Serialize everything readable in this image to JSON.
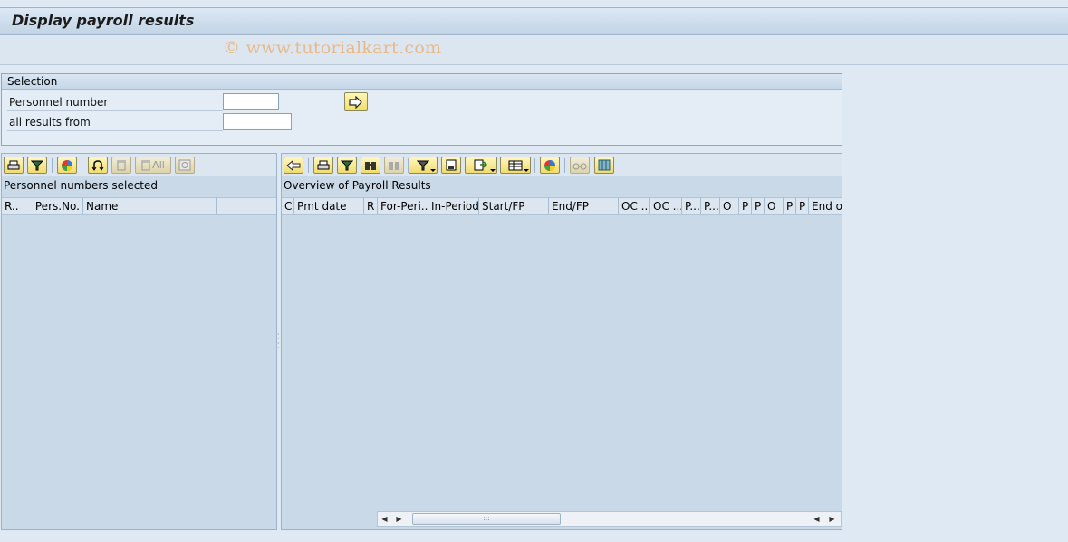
{
  "window": {
    "title": "Display payroll results",
    "watermark": "© www.tutorialkart.com"
  },
  "selection": {
    "header": "Selection",
    "fields": [
      {
        "label": "Personnel number",
        "value": ""
      },
      {
        "label": "all results from",
        "value": ""
      }
    ],
    "execute_icon": "execute-arrow-icon"
  },
  "left_panel": {
    "title": "Personnel numbers selected",
    "toolbar": [
      {
        "icon": "print-icon",
        "enabled": true
      },
      {
        "icon": "filter-icon",
        "enabled": true
      },
      {
        "icon": "color-wheel-icon",
        "enabled": true
      },
      {
        "icon": "refresh-icon",
        "enabled": true
      },
      {
        "icon": "delete-icon",
        "enabled": false
      },
      {
        "icon": "delete-all-icon",
        "label": "All",
        "enabled": false
      },
      {
        "icon": "reload-icon",
        "enabled": false
      }
    ],
    "columns": [
      "R..",
      "Pers.No.",
      "Name"
    ]
  },
  "right_panel": {
    "title": "Overview of Payroll Results",
    "toolbar": [
      {
        "icon": "back-arrow-icon",
        "enabled": true
      },
      {
        "icon": "print-icon",
        "enabled": true
      },
      {
        "icon": "filter-icon",
        "enabled": true
      },
      {
        "icon": "find-icon",
        "enabled": true
      },
      {
        "icon": "find-next-icon",
        "enabled": false
      },
      {
        "icon": "set-filter-icon",
        "enabled": true
      },
      {
        "icon": "print-preview-icon",
        "enabled": true
      },
      {
        "icon": "export-icon",
        "enabled": true
      },
      {
        "icon": "layout-icon",
        "enabled": true
      },
      {
        "icon": "color-wheel-icon",
        "enabled": true
      },
      {
        "icon": "glasses-icon",
        "enabled": false
      },
      {
        "icon": "columns-icon",
        "enabled": true
      }
    ],
    "columns": [
      "C",
      "Pmt date",
      "R",
      "For-Peri..",
      "In-Period",
      "Start/FP",
      "End/FP",
      "OC ...",
      "OC ...",
      "P...",
      "P...",
      "O",
      "P",
      "P",
      "O",
      "P",
      "P",
      "End of"
    ]
  }
}
